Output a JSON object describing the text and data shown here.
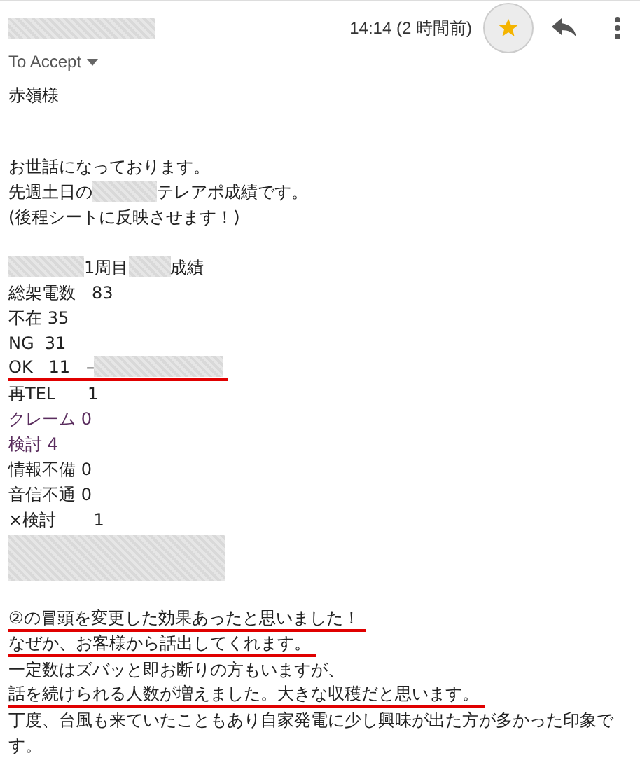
{
  "header": {
    "sender": {
      "kind": "redacted"
    },
    "time": "14:14 (2 時間前)",
    "starred": true,
    "recipient": "To Accept"
  },
  "greeting": "赤嶺様",
  "paragraphs": [
    {
      "lines": [
        {
          "segments": [
            {
              "text": "お世話になっております。"
            }
          ]
        },
        {
          "segments": [
            {
              "text": "先週土日の"
            },
            {
              "kind": "redacted"
            },
            {
              "text": "テレアポ成績です。"
            }
          ]
        },
        {
          "segments": [
            {
              "text": "(後程シートに反映させます！)"
            }
          ]
        }
      ]
    },
    {
      "lines": [
        {
          "segments": [
            {
              "kind": "redacted"
            },
            {
              "text": "1周目"
            },
            {
              "kind": "redacted"
            },
            {
              "text": "成績"
            }
          ]
        },
        {
          "segments": [
            {
              "text": "総架電数   83"
            }
          ]
        },
        {
          "segments": [
            {
              "text": "不在 35"
            }
          ]
        },
        {
          "segments": [
            {
              "text": "NG  31"
            }
          ]
        },
        {
          "segments": [
            {
              "text": "OK   11   –"
            },
            {
              "kind": "redacted"
            }
          ],
          "underlined": true
        },
        {
          "segments": [
            {
              "text": "再TEL      1"
            }
          ]
        },
        {
          "segments": [
            {
              "text": "クレーム 0"
            }
          ],
          "color": "#5a2d5e"
        },
        {
          "segments": [
            {
              "text": "検討 4"
            }
          ],
          "color": "#5a2d5e"
        },
        {
          "segments": [
            {
              "text": "情報不備 0"
            }
          ]
        },
        {
          "segments": [
            {
              "text": "音信不通 0"
            }
          ]
        },
        {
          "segments": [
            {
              "text": "×検討       1"
            }
          ]
        },
        {
          "segments": [
            {
              "kind": "redacted-block"
            }
          ]
        }
      ]
    },
    {
      "lines": [
        {
          "segments": [
            {
              "text": "②の冒頭を変更した効果あったと思いました！"
            }
          ],
          "underlined": true
        },
        {
          "segments": [
            {
              "text": "なぜか、お客様から話出してくれます。"
            }
          ],
          "underlined": true
        },
        {
          "segments": [
            {
              "text": "一定数はズバッと即お断りの方もいますが、"
            }
          ]
        },
        {
          "segments": [
            {
              "text": "話を続けられる人数が増えました。大きな収穫だと思います。"
            }
          ],
          "underlined": true
        },
        {
          "segments": [
            {
              "text": "丁度、台風も来ていたこともあり自家発電に少し興味が出た方が多かった印象です。"
            }
          ]
        }
      ]
    }
  ]
}
